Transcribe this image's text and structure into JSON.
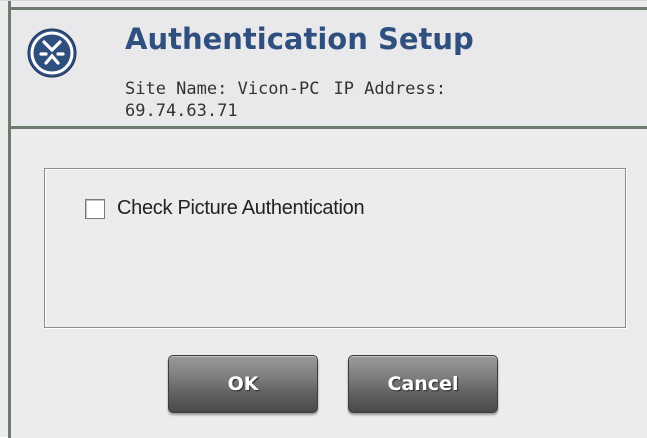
{
  "dialog": {
    "title": "Authentication Setup",
    "site_name_label": "Site Name: Vicon-PC",
    "ip_address_label": "IP Address:",
    "ip_address_value": "69.74.63.71",
    "logo_icon": "vicon-logo-icon"
  },
  "options": {
    "check_picture_auth_label": "Check Picture Authentication",
    "check_picture_auth_checked": false
  },
  "buttons": {
    "ok_label": "OK",
    "cancel_label": "Cancel"
  },
  "colors": {
    "title": "#2f4f7f",
    "logo": "#2f4f7f",
    "border": "#6f7a6f"
  }
}
